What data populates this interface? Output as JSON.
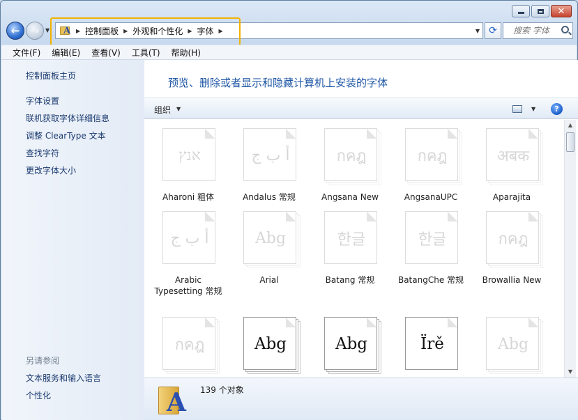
{
  "window": {
    "caption": {
      "minimize": "minimize-icon",
      "maximize": "maximize-icon",
      "close": "close-icon"
    }
  },
  "nav": {
    "breadcrumb": [
      "控制面板",
      "外观和个性化",
      "字体"
    ],
    "search_placeholder": "搜索 字体"
  },
  "menu": [
    "文件(F)",
    "编辑(E)",
    "查看(V)",
    "工具(T)",
    "帮助(H)"
  ],
  "sidebar": {
    "home": "控制面板主页",
    "links": [
      "字体设置",
      "联机获取字体详细信息",
      "调整 ClearType 文本",
      "查找字符",
      "更改字体大小"
    ],
    "see_also_title": "另请参阅",
    "see_also": [
      "文本服务和输入语言",
      "个性化"
    ]
  },
  "main": {
    "title": "预览、删除或者显示和隐藏计算机上安装的字体",
    "organize_label": "组织",
    "fonts": [
      {
        "name": "Aharoni 粗体",
        "sample": "אנץ",
        "stacked": false,
        "dark": false
      },
      {
        "name": "Andalus 常规",
        "sample": "أ ب ج",
        "stacked": false,
        "dark": false
      },
      {
        "name": "Angsana New",
        "sample": "กคฎ",
        "stacked": true,
        "dark": false
      },
      {
        "name": "AngsanaUPC",
        "sample": "กคฎ",
        "stacked": true,
        "dark": false
      },
      {
        "name": "Aparajita",
        "sample": "अबक",
        "stacked": true,
        "dark": false
      },
      {
        "name": "Arabic Typesetting 常规",
        "sample": "أ ب ج",
        "stacked": false,
        "dark": false
      },
      {
        "name": "Arial",
        "sample": "Abg",
        "stacked": true,
        "dark": false
      },
      {
        "name": "Batang 常规",
        "sample": "한글",
        "stacked": false,
        "dark": false
      },
      {
        "name": "BatangChe 常规",
        "sample": "한글",
        "stacked": false,
        "dark": false
      },
      {
        "name": "Browallia New",
        "sample": "กคฎ",
        "stacked": true,
        "dark": false
      },
      {
        "name": "",
        "sample": "กคฎ",
        "stacked": true,
        "dark": false
      },
      {
        "name": "",
        "sample": "Abg",
        "stacked": true,
        "dark": true
      },
      {
        "name": "",
        "sample": "Abg",
        "stacked": true,
        "dark": true
      },
      {
        "name": "",
        "sample": "Ïrě",
        "stacked": false,
        "dark": true
      },
      {
        "name": "",
        "sample": "Abg",
        "stacked": true,
        "dark": false
      }
    ],
    "status": "139 个对象"
  },
  "colors": {
    "accent": "#1f57a6",
    "highlight": "#f3b300",
    "link": "#1a3a6f"
  }
}
